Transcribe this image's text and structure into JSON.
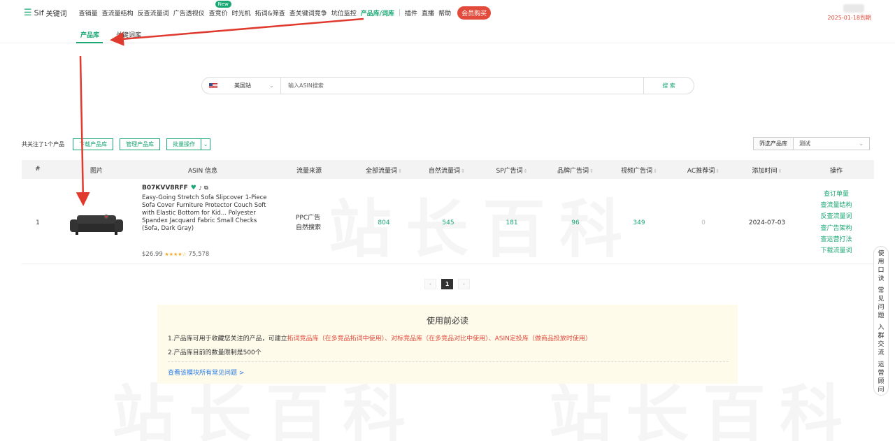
{
  "nav": {
    "logo_mark": "☰",
    "logo_brand": "Sif",
    "logo_text": "关键词",
    "items": [
      {
        "label": "查销量"
      },
      {
        "label": "查流量结构"
      },
      {
        "label": "反查流量词"
      },
      {
        "label": "广告透视仪"
      },
      {
        "label": "查竞价",
        "badge": "New"
      },
      {
        "label": "时光机"
      },
      {
        "label": "拓词&筛查"
      },
      {
        "label": "查关键词竞争"
      },
      {
        "label": "坑位监控"
      },
      {
        "label": "产品库/词库",
        "active": true
      }
    ],
    "items_after_sep": [
      {
        "label": "插件"
      },
      {
        "label": "直播"
      },
      {
        "label": "帮助"
      }
    ],
    "vip_label": "会员购买",
    "user_date": "2025-01-18到期"
  },
  "subtabs": {
    "product_lib": "产品库",
    "keyword_lib": "关键词库"
  },
  "search": {
    "site": "美国站",
    "placeholder": "输入ASIN搜索",
    "button": "搜 索"
  },
  "toolbar": {
    "followed_count": "共关注了1个产品",
    "download": "下载产品库",
    "manage": "管理产品库",
    "batch": "批量操作",
    "filter_label": "筛选产品库",
    "filter_value": "测试"
  },
  "table": {
    "headers": {
      "index": "#",
      "image": "图片",
      "asin_info": "ASIN 信息",
      "source": "流量来源",
      "all_traffic": "全部流量词",
      "organic": "自然流量词",
      "sp_ad": "SP广告词",
      "brand_ad": "品牌广告词",
      "video_ad": "视频广告词",
      "ac": "AC推荐词",
      "added": "添加时间",
      "ops": "操作"
    },
    "rows": [
      {
        "index": "1",
        "asin": "B07KVV8RFF",
        "title": "Easy-Going Stretch Sofa Slipcover 1-Piece Sofa Cover Furniture Protector Couch Soft with Elastic Bottom for Kid... Polyester Spandex Jacquard Fabric Small Checks (Sofa, Dark Gray)",
        "price": "$26.99",
        "rating_stars": "★★★★☆",
        "reviews": "75,578",
        "source_1": "PPC广告",
        "source_2": "自然搜索",
        "all_traffic": "804",
        "organic": "545",
        "sp_ad": "181",
        "brand_ad": "96",
        "video_ad": "349",
        "ac": "0",
        "added": "2024-07-03",
        "ops": [
          "查订单量",
          "查流量结构",
          "反查流量词",
          "查广告架构",
          "查运营打法",
          "下载流量词"
        ]
      }
    ]
  },
  "pager": {
    "prev": "‹",
    "current": "1",
    "next": "›"
  },
  "notice": {
    "title": "使用前必读",
    "line1_a": "1.产品库可用于收藏您关注的产品，可建立",
    "line1_red": "拓词竞品库（在多竞品拓词中使用）、对标竞品库（在多竞品对比中使用）、ASIN定投库（做商品投放时使用）",
    "line2": "2.产品库目前的数量限制是500个",
    "link": "查看该模块所有常见问题 >"
  },
  "float": [
    "使用口诀",
    "常见问题",
    "入群交流",
    "运营顾问"
  ],
  "colors": {
    "accent": "#1aa774",
    "red": "#e24b3c",
    "link": "#2d7ee6"
  }
}
